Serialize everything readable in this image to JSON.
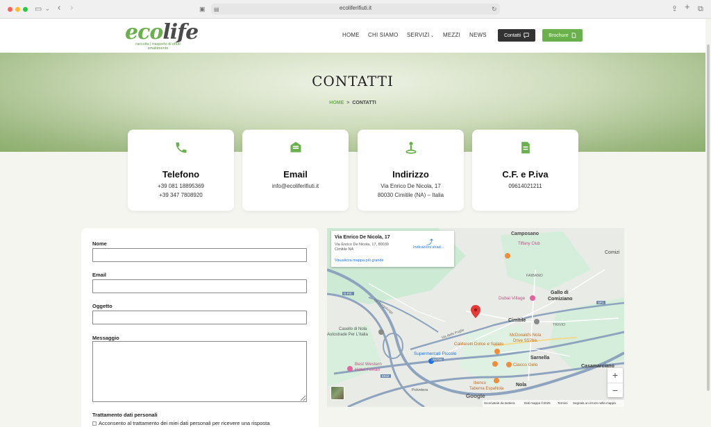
{
  "browser": {
    "url": "ecoliferifiuti.it"
  },
  "header": {
    "logo_eco": "eco",
    "logo_life": "life",
    "logo_tagline": "raccolta | trasporto di rifiuti smaltimento",
    "nav": [
      "HOME",
      "CHI SIAMO",
      "SERVIZI",
      "MEZZI",
      "NEWS"
    ],
    "btn_contatti": "Contatti",
    "btn_brochure": "Brochure"
  },
  "hero": {
    "title": "CONTATTI",
    "breadcrumb_home": "HOME",
    "breadcrumb_sep": ">",
    "breadcrumb_current": "CONTATTI"
  },
  "cards": [
    {
      "title": "Telefono",
      "lines": [
        "+39 081 18895369",
        "+39 347 7808920"
      ],
      "icon": "phone-icon"
    },
    {
      "title": "Email",
      "lines": [
        "info@ecoliferifiuti.it"
      ],
      "icon": "email-icon"
    },
    {
      "title": "Indirizzo",
      "lines": [
        "Via Enrico De Nicola, 17",
        "80030 Cimitile (NA) – Italia"
      ],
      "icon": "location-icon"
    },
    {
      "title": "C.F. e P.iva",
      "lines": [
        "09614021211"
      ],
      "icon": "document-icon"
    }
  ],
  "form": {
    "nome_label": "Nome",
    "email_label": "Email",
    "oggetto_label": "Oggetto",
    "messaggio_label": "Messaggio",
    "privacy_label": "Trattamento dati personali",
    "consent_text": "Acconsento al trattamento dei miei dati personali per ricevere una risposta"
  },
  "map": {
    "popup_title": "Via Enrico De Nicola, 17",
    "popup_address": "Via Enrico De Nicola, 17, 80030 Cimitile NA",
    "popup_directions": "Indicazioni strad...",
    "popup_link": "Visualizza mappa più grande",
    "labels": {
      "camposano": "Camposano",
      "tiffany": "Tiffany Club",
      "comiz": "Comizi",
      "faibano": "FAIBANO",
      "dubai": "Dubai Village",
      "gallo": "Gallo di",
      "comiziano": "Comiziano",
      "cimitile": "Cimitile",
      "trivio": "TRIVIO",
      "casello": "Casello di Nola",
      "autostrade": "Autostrade Per L'Italia",
      "mcdonalds": "McDonald's Nola",
      "drive": "Drive SS7bis",
      "caldarelli": "Caldarelli Dolce e Salato",
      "supermercati": "Supermercati Piccolo",
      "sarnella": "Sarnella",
      "casamarciano": "Casamarciano",
      "bestwestern": "Best Western",
      "ferrari": "Hotel Ferrari",
      "ciacco": "Ciacco Gelo",
      "nola": "Nola",
      "ibenco": "Ibenco",
      "taberna": "Taberna EspaNola",
      "polvetera": "Polvetera",
      "via_borgo": "Via Borgolungo",
      "via_puglie": "Via delle Puglie",
      "ss7bis": "SS7bis",
      "e842": "E842",
      "sp1": "SP1",
      "gpe": "G.P.E."
    },
    "zoom_in": "+",
    "zoom_out": "−",
    "google": "Google",
    "footer": [
      "Scorciatoie da tastiera",
      "Dati mappa ©2025",
      "Termini",
      "Segnala un errore nella mappa"
    ]
  },
  "colors": {
    "brand_green": "#6ab04c",
    "dark": "#333333",
    "map_pin": "#e53935"
  }
}
